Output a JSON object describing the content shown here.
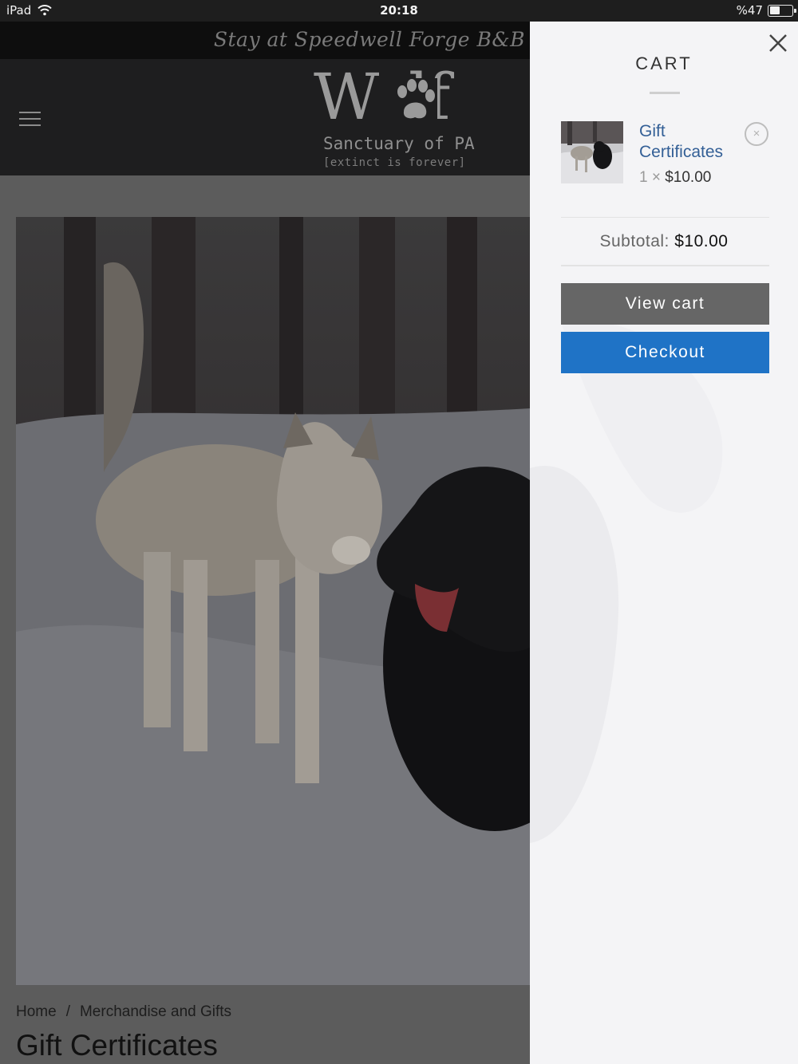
{
  "status_bar": {
    "device": "iPad",
    "time": "20:18",
    "battery": "%47",
    "battery_fill": 0.47
  },
  "site": {
    "top_strip_text": "Stay at Speedwell Forge B&B",
    "logo": {
      "title": "Wolf",
      "line1": "Sanctuary of PA",
      "line2": "[extinct is forever]"
    },
    "breadcrumb": [
      "Home",
      "Merchandise and Gifts"
    ],
    "breadcrumb_sep": "/",
    "product_title": "Gift Certificates"
  },
  "cart": {
    "title": "CART",
    "items": [
      {
        "name": "Gift Certificates",
        "qty_prefix": "1 ×",
        "price": "$10.00"
      }
    ],
    "remove_symbol": "×",
    "subtotal_label": "Subtotal:",
    "subtotal_amount": "$10.00",
    "view_cart_label": "View cart",
    "checkout_label": "Checkout"
  },
  "colors": {
    "checkout": "#1f73c6",
    "view_cart": "#666666",
    "link": "#335f96"
  }
}
